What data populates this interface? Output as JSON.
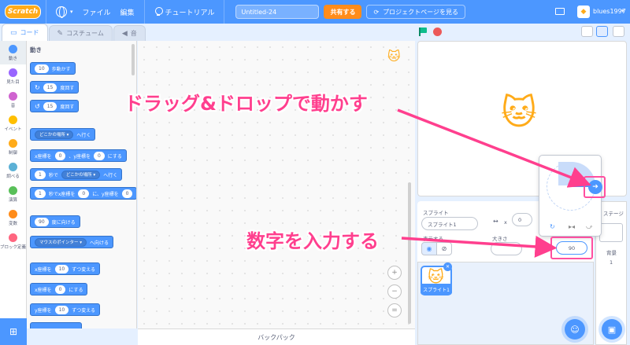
{
  "menubar": {
    "logo": "Scratch",
    "language_caret": "▾",
    "file": "ファイル",
    "edit": "編集",
    "tutorial": "チュートリアル",
    "project_title": "Untitled-24",
    "share": "共有する",
    "project_page": "プロジェクトページを見る",
    "username": "blues1997",
    "user_caret": "▾"
  },
  "tabs": {
    "code": "コード",
    "costume": "コスチューム",
    "sound": "音"
  },
  "categories": [
    {
      "label": "動き",
      "color": "#4c97ff"
    },
    {
      "label": "見た目",
      "color": "#9966ff"
    },
    {
      "label": "音",
      "color": "#cf63cf"
    },
    {
      "label": "イベント",
      "color": "#ffbf00"
    },
    {
      "label": "制御",
      "color": "#ffab19"
    },
    {
      "label": "調べる",
      "color": "#5cb1d6"
    },
    {
      "label": "演算",
      "color": "#59c059"
    },
    {
      "label": "変数",
      "color": "#ff8c1a"
    },
    {
      "label": "ブロック定義",
      "color": "#ff6680"
    }
  ],
  "palette": {
    "title": "動き",
    "move_steps": {
      "num": "10",
      "text": "歩動かす"
    },
    "turn_right": {
      "icon": "↻",
      "num": "15",
      "text": "度回す"
    },
    "turn_left": {
      "icon": "↺",
      "num": "15",
      "text": "度回す"
    },
    "goto": {
      "drop": "どこかの場所 ▾",
      "text": "へ行く"
    },
    "goto_xy": {
      "t1": "x座標を",
      "n1": "0",
      "t2": "、y座標を",
      "n2": "0",
      "t3": "にする"
    },
    "glide_to": {
      "num": "1",
      "t1": "秒で",
      "drop": "どこかの場所 ▾",
      "t2": "へ行く"
    },
    "glide_xy": {
      "num": "1",
      "t1": "秒でx座標を",
      "n1": "0",
      "t2": "に、y座標を",
      "n2": "0"
    },
    "point_dir": {
      "num": "90",
      "text": "度に向ける"
    },
    "point_towards": {
      "drop": "マウスのポインター ▾",
      "text": "へ向ける"
    },
    "change_x": {
      "t1": "x座標を",
      "num": "10",
      "t2": "ずつ変える"
    },
    "set_x": {
      "t1": "x座標を",
      "num": "0",
      "t2": "にする"
    },
    "change_y": {
      "t1": "y座標を",
      "num": "10",
      "t2": "ずつ変える"
    }
  },
  "scripts": {
    "zoom_in": "+",
    "zoom_out": "−",
    "zoom_reset": "="
  },
  "backpack": "バックパック",
  "sprite_info": {
    "sprite_label": "スプライト",
    "sprite_name": "スプライト1",
    "x_label": "x",
    "x_value": "0",
    "show_label": "表示する",
    "size_label": "大きさ"
  },
  "sprite_list": {
    "item_label": "スプライト1"
  },
  "stage_pane": {
    "title": "ステージ",
    "backdrop_label": "背景",
    "backdrop_count": "1"
  },
  "direction_popup": {
    "value": "90"
  },
  "annotations": {
    "drag_text": "ドラッグ&ドロップで動かす",
    "input_text": "数字を入力する",
    "color": "#ff3f8e"
  }
}
